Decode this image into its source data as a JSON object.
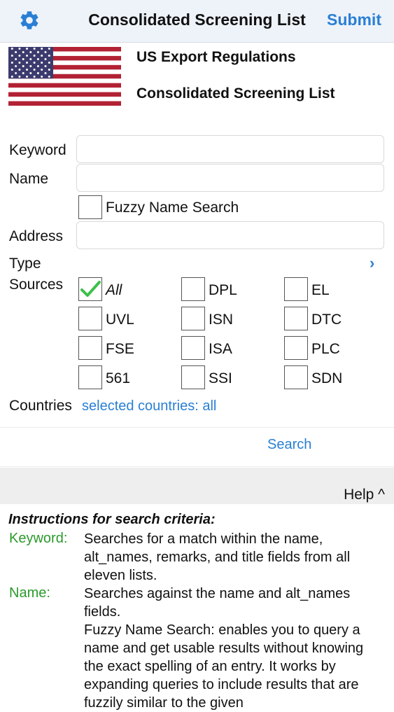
{
  "nav": {
    "title": "Consolidated Screening List",
    "submit_label": "Submit",
    "settings_icon": "gear-icon"
  },
  "header": {
    "flag_icon": "us-flag-icon",
    "line1": "US Export Regulations",
    "line2": "Consolidated Screening List"
  },
  "form": {
    "keyword_label": "Keyword",
    "keyword_value": "",
    "name_label": "Name",
    "name_value": "",
    "fuzzy_label": "Fuzzy Name Search",
    "fuzzy_checked": false,
    "address_label": "Address",
    "address_value": "",
    "type_label": "Type",
    "type_chevron": "›",
    "sources_label": "Sources",
    "sources": [
      {
        "label": "All",
        "checked": true
      },
      {
        "label": "DPL",
        "checked": false
      },
      {
        "label": "EL",
        "checked": false
      },
      {
        "label": "UVL",
        "checked": false
      },
      {
        "label": "ISN",
        "checked": false
      },
      {
        "label": "DTC",
        "checked": false
      },
      {
        "label": "FSE",
        "checked": false
      },
      {
        "label": "ISA",
        "checked": false
      },
      {
        "label": "PLC",
        "checked": false
      },
      {
        "label": "561",
        "checked": false
      },
      {
        "label": "SSI",
        "checked": false
      },
      {
        "label": "SDN",
        "checked": false
      }
    ],
    "countries_label": "Countries",
    "countries_value": "selected countries: all",
    "search_label": "Search"
  },
  "help_label": "Help ^",
  "instructions": {
    "title": "Instructions for search criteria:",
    "keyword_term": "Keyword:",
    "keyword_text": "Searches for a match within the name, alt_names, remarks, and title fields from all eleven lists.",
    "name_term": "Name:",
    "name_text": "Searches against the name and alt_names fields.",
    "fuzzy_text": "Fuzzy Name Search: enables you to query a name and get usable results without knowing the exact spelling of an entry. It works by expanding queries to include results that are fuzzily similar to the given"
  },
  "colors": {
    "accent": "#2a7fd4",
    "term_green": "#2b9a2b",
    "check_green": "#3cc04a"
  }
}
